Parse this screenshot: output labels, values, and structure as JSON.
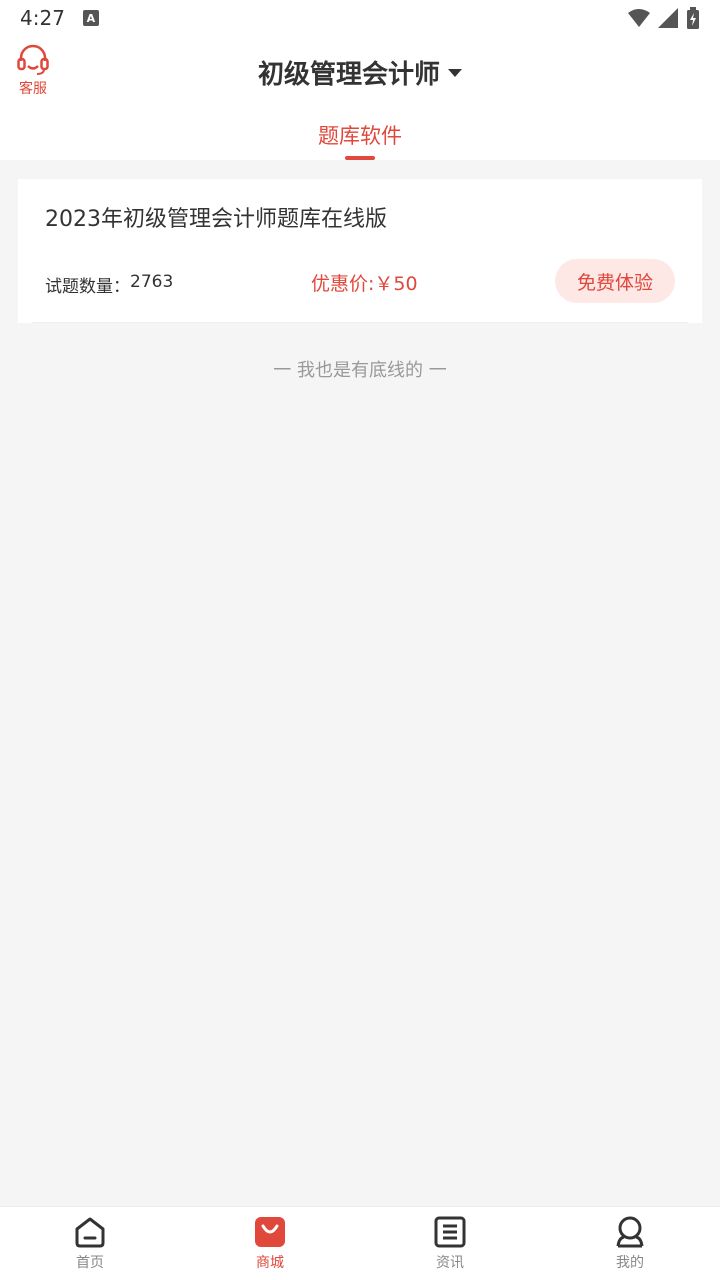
{
  "status_bar": {
    "time": "4:27",
    "notification_badge": "A"
  },
  "header": {
    "customer_service_label": "客服",
    "title": "初级管理会计师",
    "tab_label": "题库软件"
  },
  "product": {
    "title": "2023年初级管理会计师题库在线版",
    "count_label": "试题数量：",
    "count_value": "2763",
    "price_label": "优惠价:",
    "price_value": "￥50",
    "trial_button": "免费体验"
  },
  "end_text": "一 我也是有底线的 一",
  "bottom_nav": {
    "items": [
      {
        "label": "首页",
        "icon": "home-icon",
        "active": false
      },
      {
        "label": "商城",
        "icon": "shop-bag-icon",
        "active": true
      },
      {
        "label": "资讯",
        "icon": "news-icon",
        "active": false
      },
      {
        "label": "我的",
        "icon": "profile-icon",
        "active": false
      }
    ]
  },
  "colors": {
    "accent": "#e0483b",
    "accent_light": "#fde8e6",
    "background": "#f5f5f5"
  }
}
